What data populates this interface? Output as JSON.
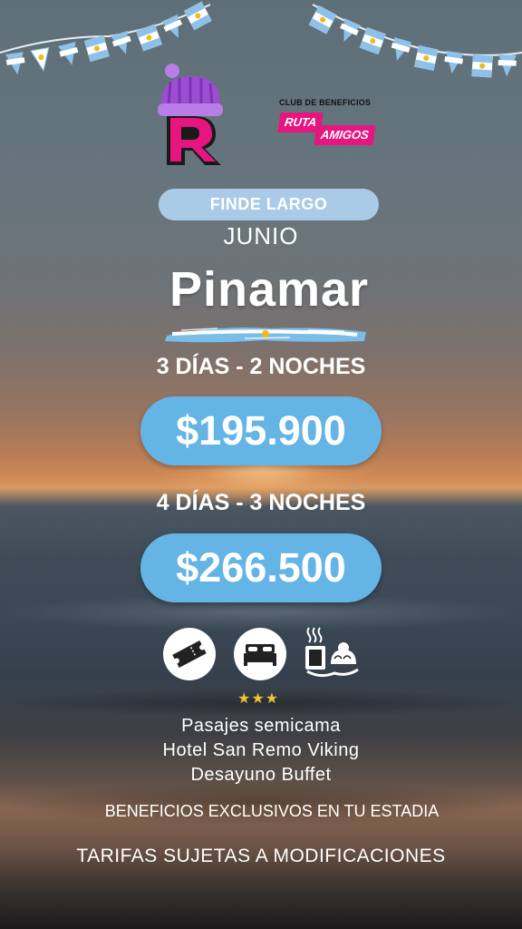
{
  "brand": {
    "club_label": "CLUB DE BENEFICIOS",
    "club_word1": "RUTA",
    "club_word2": "AMIGOS"
  },
  "promo": {
    "badge": "FINDE LARGO",
    "month": "JUNIO",
    "destination": "Pinamar"
  },
  "packages": [
    {
      "duration": "3 DÍAS - 2 NOCHES",
      "price": "$195.900"
    },
    {
      "duration": "4 DÍAS - 3 NOCHES",
      "price": "$266.500"
    }
  ],
  "amenities": {
    "icons": [
      "ticket-icon",
      "bed-icon",
      "breakfast-icon"
    ],
    "stars": "★★★",
    "items": [
      "Pasajes semicama",
      "Hotel San Remo Viking",
      "Desayuno Buffet"
    ]
  },
  "notes": {
    "benefits": "BENEFICIOS EXCLUSIVOS EN TU ESTADIA",
    "disclaimer": "TARIFAS SUJETAS A MODIFICACIONES"
  },
  "colors": {
    "price_pill": "#64b5e6",
    "badge_pill": "#a9cbe8",
    "brand_pink": "#e6157f",
    "beanie_purple": "#9b4fd0",
    "star_gold": "#f2c230"
  }
}
